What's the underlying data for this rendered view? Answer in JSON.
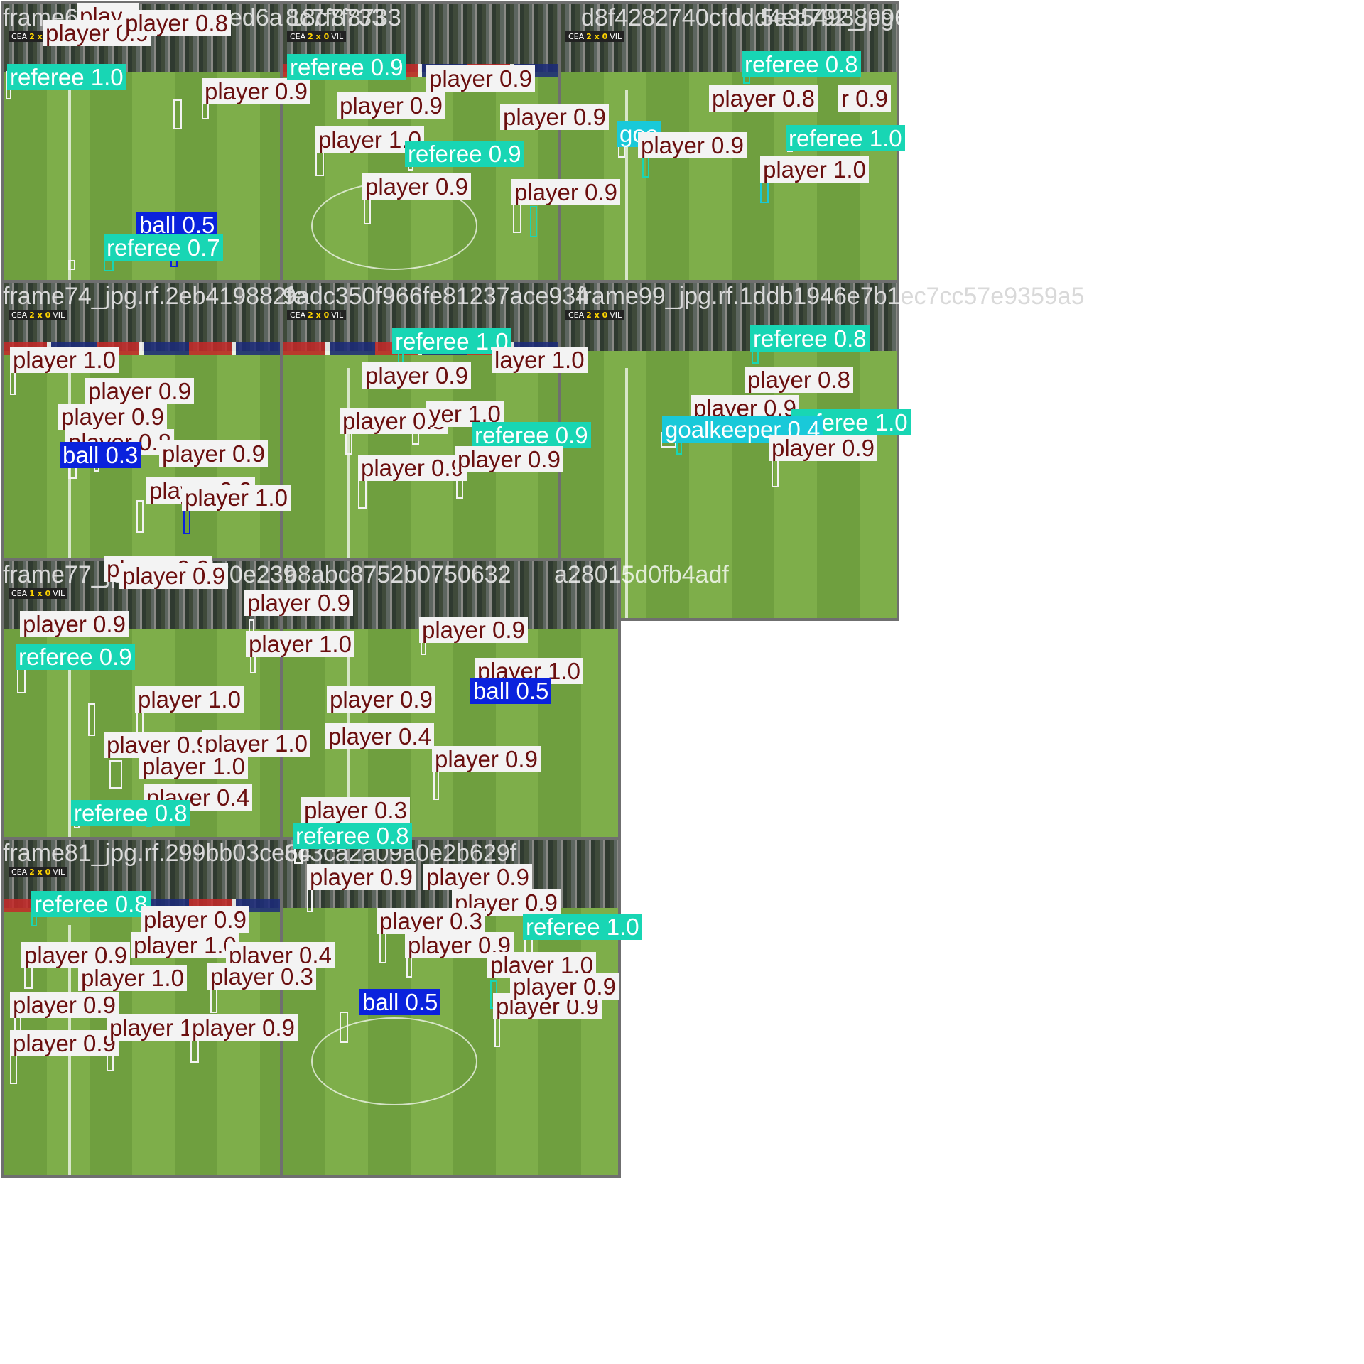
{
  "tiles": [
    {
      "title": "frame6",
      "scorebug": {
        "home": "CEA",
        "score": "2 x 0",
        "away": "VIL"
      },
      "labels": [
        {
          "cls": "player",
          "text": "playe"
        },
        {
          "cls": "player",
          "text": "player 0.9"
        },
        {
          "cls": "player",
          "text": "player 0.8"
        },
        {
          "cls": "referee",
          "text": "referee 1.0"
        },
        {
          "cls": "player",
          "text": "player 0.9"
        },
        {
          "cls": "ball",
          "text": "ball 0.5"
        },
        {
          "cls": "referee",
          "text": "referee 0.7"
        }
      ]
    },
    {
      "title": "18c7f8733",
      "scorebug": {
        "home": "CEA",
        "score": "2 x 0",
        "away": "VIL"
      },
      "labels": [
        {
          "cls": "referee",
          "text": "referee 0.9"
        },
        {
          "cls": "player",
          "text": "player 0.9"
        },
        {
          "cls": "player",
          "text": "player 0.9"
        },
        {
          "cls": "player",
          "text": "player 0.9"
        },
        {
          "cls": "player",
          "text": "player 1.0"
        },
        {
          "cls": "referee",
          "text": "referee 0.9"
        },
        {
          "cls": "player",
          "text": "player 0.9"
        },
        {
          "cls": "player",
          "text": "player 0.9"
        }
      ]
    },
    {
      "title": "d8f4282740cfddd4ed792_jpg",
      "scorebug": {
        "home": "CEA",
        "score": "2 x 0",
        "away": "VIL"
      },
      "labels": [
        {
          "cls": "referee",
          "text": "referee 0.8"
        },
        {
          "cls": "player",
          "text": "player 0.8"
        },
        {
          "cls": "player",
          "text": "r 0.9"
        },
        {
          "cls": "referee",
          "text": "referee 1.0"
        },
        {
          "cls": "goalkeeper",
          "text": "goa"
        },
        {
          "cls": "player",
          "text": "player 0.9"
        },
        {
          "cls": "player",
          "text": "player 1.0"
        }
      ]
    },
    {
      "title": "frame74_jpg.rf.2eb419882fe",
      "scorebug": {
        "home": "CEA",
        "score": "2 x 0",
        "away": "VIL"
      },
      "labels": [
        {
          "cls": "player",
          "text": "player 1.0"
        },
        {
          "cls": "player",
          "text": "player 0.9"
        },
        {
          "cls": "player",
          "text": "player 0.9"
        },
        {
          "cls": "player",
          "text": "player 0.8"
        },
        {
          "cls": "ball",
          "text": "ball 0.3"
        },
        {
          "cls": "player",
          "text": "player 0.9"
        },
        {
          "cls": "player",
          "text": "player 0.9"
        },
        {
          "cls": "player",
          "text": "player 1.0"
        }
      ]
    },
    {
      "title": "9adc350f966fe81237ace934",
      "scorebug": {
        "home": "CEA",
        "score": "2 x 0",
        "away": "VIL"
      },
      "labels": [
        {
          "cls": "referee",
          "text": "referee 1.0"
        },
        {
          "cls": "player",
          "text": "player 0.9"
        },
        {
          "cls": "player",
          "text": "layer 1.0"
        },
        {
          "cls": "player",
          "text": "player 0.8"
        },
        {
          "cls": "player",
          "text": "yer 1.0"
        },
        {
          "cls": "referee",
          "text": "referee 0.9"
        },
        {
          "cls": "player",
          "text": "player 0.9"
        },
        {
          "cls": "player",
          "text": "player 0.9"
        }
      ]
    },
    {
      "title": "frame99_jpg.rf.1ddb1946e7b1ec7cc57e9359a5",
      "scorebug": {
        "home": "CEA",
        "score": "2 x 0",
        "away": "VIL"
      },
      "labels": [
        {
          "cls": "referee",
          "text": "referee 0.8"
        },
        {
          "cls": "player",
          "text": "player 0.8"
        },
        {
          "cls": "player",
          "text": "player 0.9"
        },
        {
          "cls": "referee",
          "text": "referee 1.0"
        },
        {
          "cls": "goalkeeper",
          "text": "goalkeeper 0.4"
        },
        {
          "cls": "player",
          "text": "player 0.9"
        }
      ]
    },
    {
      "title": "frame77_jp",
      "scorebug": {
        "home": "CEA",
        "score": "1 x 0",
        "away": "VIL"
      },
      "labels": [
        {
          "cls": "player",
          "text": "player 0.9"
        },
        {
          "cls": "player",
          "text": "player 0.9"
        },
        {
          "cls": "player",
          "text": "player 0.9"
        },
        {
          "cls": "referee",
          "text": "referee 0.9"
        },
        {
          "cls": "player",
          "text": "player 1.0"
        },
        {
          "cls": "player",
          "text": "player 0.9"
        },
        {
          "cls": "player",
          "text": "player 1.0"
        },
        {
          "cls": "player",
          "text": "player 1.0"
        },
        {
          "cls": "player",
          "text": "player 0.4"
        },
        {
          "cls": "referee",
          "text": "referee 0.8"
        }
      ]
    },
    {
      "title": "b8abc8752b0750632",
      "scorebug": null,
      "labels": [
        {
          "cls": "player",
          "text": "player 0.9"
        },
        {
          "cls": "player",
          "text": "player 0.9"
        },
        {
          "cls": "player",
          "text": "player 1.0"
        },
        {
          "cls": "player",
          "text": "player 1.0"
        },
        {
          "cls": "player",
          "text": "player 0.9"
        },
        {
          "cls": "ball",
          "text": "ball 0.5"
        },
        {
          "cls": "player",
          "text": "player 0.4"
        },
        {
          "cls": "player",
          "text": "player 0.9"
        },
        {
          "cls": "player",
          "text": "player 0.3"
        },
        {
          "cls": "referee",
          "text": "referee 0.8"
        }
      ]
    },
    {
      "title": "frame81_jpg.rf.299bb03ce64",
      "scorebug": {
        "home": "CEA",
        "score": "2 x 0",
        "away": "VIL"
      },
      "labels": [
        {
          "cls": "referee",
          "text": "referee 0.8"
        },
        {
          "cls": "player",
          "text": "player 0.9"
        },
        {
          "cls": "player",
          "text": "player 1.0"
        },
        {
          "cls": "player",
          "text": "player 0.9"
        },
        {
          "cls": "player",
          "text": "player 0.4"
        },
        {
          "cls": "player",
          "text": "player 1.0"
        },
        {
          "cls": "player",
          "text": "player 0.3"
        },
        {
          "cls": "player",
          "text": "player 0.9"
        },
        {
          "cls": "player",
          "text": "player 0.9"
        },
        {
          "cls": "player",
          "text": "player 1.0"
        },
        {
          "cls": "player",
          "text": "player 0.9"
        }
      ]
    },
    {
      "title": "8c3ca2a09a0e2b629f",
      "scorebug": null,
      "labels": [
        {
          "cls": "player",
          "text": "player 0.9"
        },
        {
          "cls": "player",
          "text": "player 0.9"
        },
        {
          "cls": "player",
          "text": "player 0.9"
        },
        {
          "cls": "player",
          "text": "player 0.3"
        },
        {
          "cls": "referee",
          "text": "referee 1.0"
        },
        {
          "cls": "player",
          "text": "player 0.9"
        },
        {
          "cls": "player",
          "text": "player 1.0"
        },
        {
          "cls": "player",
          "text": "player 0.9"
        },
        {
          "cls": "ball",
          "text": "ball 0.5"
        },
        {
          "cls": "player",
          "text": "player 0.9"
        }
      ]
    }
  ],
  "watermarks": [
    {
      "text": "ed6a"
    },
    {
      "text": "8c7f8733"
    },
    {
      "text": "5e3549389960928604"
    },
    {
      "text": "70e239"
    },
    {
      "text": "a28015d0fb4adf"
    }
  ],
  "colors": {
    "player": "#f3f3f3",
    "referee": "#18d6b4",
    "ball": "#0a22dd",
    "goalkeeper": "#19c9d9",
    "tile_border": "#6f6f6f"
  }
}
